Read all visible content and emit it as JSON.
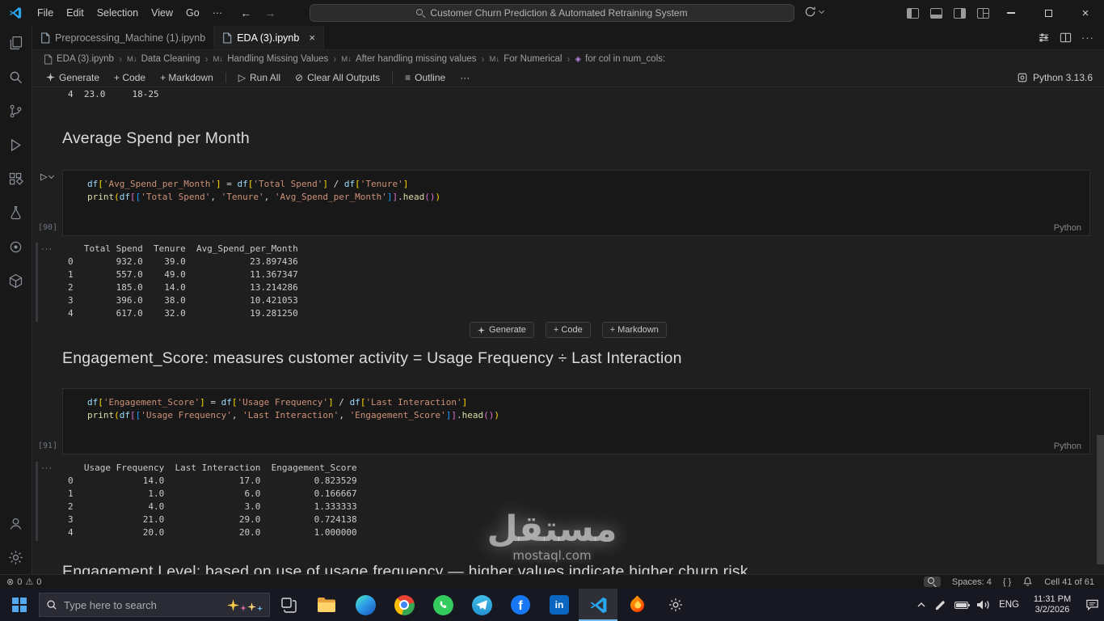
{
  "titlebar": {
    "menu_file": "File",
    "menu_edit": "Edit",
    "menu_selection": "Selection",
    "menu_view": "View",
    "menu_go": "Go",
    "menu_more": "···",
    "search_text": "Customer Churn Prediction & Automated Retraining System"
  },
  "tabs": {
    "tab1_label": "Preprocessing_Machine (1).ipynb",
    "tab2_label": "EDA (3).ipynb",
    "close": "×",
    "more": "···"
  },
  "breadcrumb": {
    "items": [
      "EDA (3).ipynb",
      "Data Cleaning",
      "Handling Missing Values",
      "After handling missing values",
      "For Numerical",
      "for col in num_cols:"
    ]
  },
  "nb_toolbar": {
    "generate": "Generate",
    "add_code": "+ Code",
    "add_markdown": "+ Markdown",
    "run_all": "Run All",
    "clear_outputs": "Clear All Outputs",
    "outline": "Outline",
    "more": "···",
    "kernel": "Python 3.13.6"
  },
  "icons": {
    "back": "←",
    "forward": "→",
    "run": "▷",
    "clear": "⊘",
    "outline": "≡",
    "sep": "›",
    "md": "M↓",
    "error": "⊗",
    "warning": "⚠",
    "facebook_f": "f",
    "linkedin_in": "in",
    "dots": "···"
  },
  "notebook": {
    "top_partial_output": "4  23.0     18-25",
    "heading1": "Average Spend per Month",
    "cell1": {
      "exec": "[90]",
      "lang": "Python",
      "code": [
        [
          [
            "v",
            "df"
          ],
          [
            "b1",
            "["
          ],
          [
            "s",
            "'Avg_Spend_per_Month'"
          ],
          [
            "b1",
            "]"
          ],
          [
            "p",
            " = "
          ],
          [
            "v",
            "df"
          ],
          [
            "b1",
            "["
          ],
          [
            "s",
            "'Total Spend'"
          ],
          [
            "b1",
            "]"
          ],
          [
            "p",
            " / "
          ],
          [
            "v",
            "df"
          ],
          [
            "b1",
            "["
          ],
          [
            "s",
            "'Tenure'"
          ],
          [
            "b1",
            "]"
          ]
        ],
        [
          [
            "f",
            "print"
          ],
          [
            "b1",
            "("
          ],
          [
            "v",
            "df"
          ],
          [
            "b2",
            "["
          ],
          [
            "b3",
            "["
          ],
          [
            "s",
            "'Total Spend'"
          ],
          [
            "p",
            ", "
          ],
          [
            "s",
            "'Tenure'"
          ],
          [
            "p",
            ", "
          ],
          [
            "s",
            "'Avg_Spend_per_Month'"
          ],
          [
            "b3",
            "]"
          ],
          [
            "b2",
            "]"
          ],
          [
            "p",
            "."
          ],
          [
            "f",
            "head"
          ],
          [
            "b2",
            "("
          ],
          [
            "b2",
            ")"
          ],
          [
            "b1",
            ")"
          ]
        ]
      ],
      "output": "   Total Spend  Tenure  Avg_Spend_per_Month\n0        932.0    39.0            23.897436\n1        557.0    49.0            11.367347\n2        185.0    14.0            13.214286\n3        396.0    38.0            10.421053\n4        617.0    32.0            19.281250"
    },
    "insert_bar": {
      "generate": "Generate",
      "add_code": "+ Code",
      "add_markdown": "+ Markdown"
    },
    "heading2": "Engagement_Score: measures customer activity = Usage Frequency ÷ Last Interaction",
    "cell2": {
      "exec": "[91]",
      "lang": "Python",
      "code": [
        [
          [
            "v",
            "df"
          ],
          [
            "b1",
            "["
          ],
          [
            "s",
            "'Engagement_Score'"
          ],
          [
            "b1",
            "]"
          ],
          [
            "p",
            " = "
          ],
          [
            "v",
            "df"
          ],
          [
            "b1",
            "["
          ],
          [
            "s",
            "'Usage Frequency'"
          ],
          [
            "b1",
            "]"
          ],
          [
            "p",
            " / "
          ],
          [
            "v",
            "df"
          ],
          [
            "b1",
            "["
          ],
          [
            "s",
            "'Last Interaction'"
          ],
          [
            "b1",
            "]"
          ]
        ],
        [
          [
            "f",
            "print"
          ],
          [
            "b1",
            "("
          ],
          [
            "v",
            "df"
          ],
          [
            "b2",
            "["
          ],
          [
            "b3",
            "["
          ],
          [
            "s",
            "'Usage Frequency'"
          ],
          [
            "p",
            ", "
          ],
          [
            "s",
            "'Last Interaction'"
          ],
          [
            "p",
            ", "
          ],
          [
            "s",
            "'Engagement_Score'"
          ],
          [
            "b3",
            "]"
          ],
          [
            "b2",
            "]"
          ],
          [
            "p",
            "."
          ],
          [
            "f",
            "head"
          ],
          [
            "b2",
            "("
          ],
          [
            "b2",
            ")"
          ],
          [
            "b1",
            ")"
          ]
        ]
      ],
      "output": "   Usage Frequency  Last Interaction  Engagement_Score\n0             14.0              17.0          0.823529\n1              1.0               6.0          0.166667\n2              4.0               3.0          1.333333\n3             21.0              29.0          0.724138\n4             20.0              20.0          1.000000"
    },
    "bottom_partial": "Engagement Level: based on use of usage frequency — higher values indicate higher churn risk"
  },
  "watermark": {
    "name": "مستقل",
    "site": "mostaql.com"
  },
  "statusbar": {
    "errors": "0",
    "warnings": "0",
    "spaces": "Spaces: 4",
    "braces": "{ }",
    "cell_pos": "Cell 41 of 61"
  },
  "taskbar": {
    "search_placeholder": "Type here to search",
    "lang": "ENG",
    "time": "11:31 PM",
    "date": "3/2/2026"
  }
}
